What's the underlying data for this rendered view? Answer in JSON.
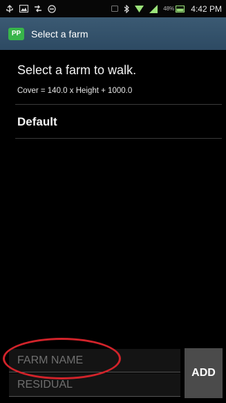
{
  "status_bar": {
    "time": "4:42 PM",
    "battery_percent": "48%",
    "icons_left": [
      "usb-icon",
      "image-icon",
      "sync-icon",
      "dnd-icon"
    ],
    "icons_right": [
      "nfc-icon",
      "bluetooth-icon",
      "wifi-icon",
      "signal-icon",
      "battery-icon"
    ]
  },
  "action_bar": {
    "app_icon_text": "PP",
    "title": "Select a farm"
  },
  "main": {
    "heading": "Select a farm to walk.",
    "formula": "Cover = 140.0 x Height + 1000.0",
    "farms": [
      {
        "label": "Default"
      }
    ]
  },
  "form": {
    "farm_name_placeholder": "FARM NAME",
    "residual_placeholder": "RESIDUAL",
    "add_label": "ADD"
  },
  "colors": {
    "action_bar": "#2d4a63",
    "app_icon": "#38b54a",
    "highlight": "#d1232a",
    "add_button": "#4b4b4b"
  }
}
